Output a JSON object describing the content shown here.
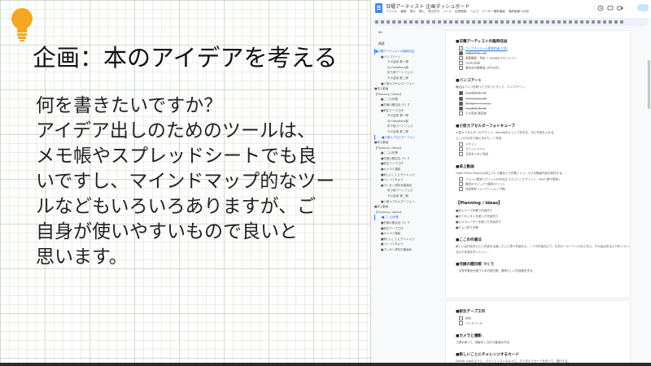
{
  "slide": {
    "title": "企画：本のアイデアを考える",
    "body_lines": [
      "何を書きたいですか？",
      "アイデア出しのためのツールは、",
      "メモ帳やスプレッドシートでも良",
      "いですし、マインドマップ的なツー",
      "ルなどもいろいろありますが、ご",
      "自身が使いやすいもので良いと",
      "思います。"
    ],
    "colors": {
      "bulb": "#f5a623",
      "grid": "#a0b996"
    }
  },
  "docs": {
    "title": "日曜アーティスト 企画ダッシュボード",
    "menu": [
      "ファイル",
      "編集",
      "表示",
      "挿入",
      "表示形式",
      "ツール",
      "拡張機能",
      "ヘルプ",
      "ユーザー補助機能",
      "最終編集:5分前"
    ],
    "icons": [
      "docs-logo-icon",
      "star-icon",
      "history-icon",
      "comment-icon",
      "video-icon",
      "share-icon"
    ],
    "outline": {
      "back_label": "←",
      "heading": "概要",
      "items": [
        {
          "label": "■日曜アーティストの臨時収益",
          "level": 1,
          "active": true
        },
        {
          "label": "■バンコアート",
          "level": 2,
          "active": false
        },
        {
          "label": "その芸術 第一弾",
          "level": 3,
          "active": false
        },
        {
          "label": "Art Relations部",
          "level": 3,
          "active": false
        },
        {
          "label": "折り紙アートフェス",
          "level": 3,
          "active": false
        },
        {
          "label": "その芸術 第二弾",
          "level": 3,
          "active": false
        },
        {
          "label": "■小型カプセルダーフォト",
          "level": 2,
          "active": false
        },
        {
          "label": "■卓上動画",
          "level": 1,
          "active": false
        },
        {
          "label": "【Planning / Ideas】",
          "level": 1,
          "active": false
        },
        {
          "label": "■ここの作業",
          "level": 2,
          "active": false
        },
        {
          "label": "■究極の題目目 づくり",
          "level": 2,
          "active": false
        },
        {
          "label": "■新生テープ工作",
          "level": 2,
          "active": false
        },
        {
          "label": "その芸術 第一弾",
          "level": 3,
          "active": false
        },
        {
          "label": "Art Relations部",
          "level": 3,
          "active": false
        },
        {
          "label": "折り紙アートフェス",
          "level": 3,
          "active": false
        },
        {
          "label": "その芸術 第二弾",
          "level": 3,
          "active": false
        },
        {
          "label": "■小型カプセルダーフォト",
          "level": 2,
          "active": true
        },
        {
          "label": "■卓上動画",
          "level": 1,
          "active": false
        },
        {
          "label": "【Planning / Ideas】",
          "level": 1,
          "active": false
        },
        {
          "label": "■ここの作業",
          "level": 2,
          "active": false
        },
        {
          "label": "■究極の題目目 づくり",
          "level": 2,
          "active": false
        },
        {
          "label": "■新生テープ工作",
          "level": 2,
          "active": false
        },
        {
          "label": "■カメラと撮影",
          "level": 2,
          "active": false
        },
        {
          "label": "■新しいことにチャレンジ",
          "level": 2,
          "active": false
        },
        {
          "label": "■つくってみよう",
          "level": 2,
          "active": false
        },
        {
          "label": "■プレゼン資料を動画化",
          "level": 2,
          "active": false
        },
        {
          "label": "折り紙アートフェス",
          "level": 3,
          "active": false
        },
        {
          "label": "その芸術 第二弾",
          "level": 3,
          "active": false
        },
        {
          "label": "■小型カプセルダーフォト",
          "level": 2,
          "active": false
        },
        {
          "label": "■卓上動画",
          "level": 1,
          "active": false
        },
        {
          "label": "【Planning / Ideas】",
          "level": 1,
          "active": false
        },
        {
          "label": "■ここの作業",
          "level": 2,
          "active": true
        },
        {
          "label": "■究極の題目目 づくり",
          "level": 2,
          "active": false
        },
        {
          "label": "■新生テープ工作",
          "level": 2,
          "active": false
        },
        {
          "label": "■カメラと撮影",
          "level": 2,
          "active": false
        },
        {
          "label": "■新しいことにチャレンジ",
          "level": 2,
          "active": false
        },
        {
          "label": "■つくってみよう",
          "level": 2,
          "active": false
        },
        {
          "label": "■プレゼン資料を動画化",
          "level": 2,
          "active": false
        }
      ]
    },
    "page1": {
      "sections": [
        {
          "heading": "■日曜アーティストの臨時収益",
          "text": [],
          "checks": [
            {
              "label": "ライブストリーム配信計画 (7月)",
              "state": "link"
            },
            {
              "label": "作業系準備 一覧",
              "state": "done"
            },
            {
              "label": "振替確認・特定 → Googleドキュメント",
              "state": "off"
            },
            {
              "label": "Hooks企画",
              "state": "off"
            },
            {
              "label": "優先交付業務量 (4円以内)",
              "state": "off"
            }
          ]
        },
        {
          "heading": "■バンコアート",
          "text": [
            "最近はバンコを彫ったり作ったりして、バンコアート。"
          ],
          "checks": [
            {
              "label": "その芸術 第一弾",
              "state": "done"
            },
            {
              "label": "Art Relations部",
              "state": "done"
            },
            {
              "label": "折り紙アートフェス",
              "state": "done"
            },
            {
              "label": "その芸術 第二弾",
              "state": "done"
            },
            {
              "label": "その芸術 第四弾",
              "state": "off"
            }
          ]
        },
        {
          "heading": "■小型カプセルダーフォトキューブ",
          "text": [
            "小型カプセルダーのデザイン、Sofubbのキューブを作る。中に写真を入れる。",
            "どこかのお店で使えるかも…→ 作品"
          ],
          "checks": [
            {
              "label": "デザイン",
              "state": "off"
            },
            {
              "label": "プリントアウト",
              "state": "off"
            },
            {
              "label": "写真を入れて完成",
              "state": "off"
            }
          ]
        },
        {
          "heading": "■卓上動画",
          "text": [
            "Open Press Projectの卓上プレス機などで作業シリン、小さな動画作品を制作する。"
          ],
          "checks": [
            {
              "label": "イメージ配布 (プリントの方式は【ゴンビニでプリント、Gsef (便で配布)",
              "state": "off"
            },
            {
              "label": "素材のマジックで配布プリント",
              "state": "off"
            },
            {
              "label": "作品制作 (ユーラーショップ他)",
              "state": "off"
            }
          ]
        }
      ],
      "planning_heading": "【Planning / Ideas】",
      "planning_items": [
        "■卓上テープ作業で作品作り",
        "■ガーゼンタンを使った作品作り",
        "■カメラレーザーを使った作品作り",
        "■チョコ作り作業"
      ],
      "sections2": [
        {
          "heading": "■ここの作業法",
          "text": [
            "新しい会作品をもとに作品を企画したいと思う作品など。ノフの作品などで、紅白ケーキーベリやなどなど。その会は作るより作っていく作品も",
            "なので作品を作っていく..."
          ]
        },
        {
          "heading": "■究極の題目帳 づくり",
          "text": [
            "・文房作業品を使うための題日帳、素晴らしい作品帳を作る"
          ]
        }
      ]
    },
    "page2": {
      "sections": [
        {
          "heading": "■新生テープ工作",
          "text": [],
          "checks": [
            {
              "label": "材料",
              "state": "off"
            },
            {
              "label": "ハンドツール",
              "state": "off"
            }
          ]
        },
        {
          "heading": "■カメラと撮影",
          "text": [
            "三脚を使って、撮影をしながら動画を作る"
          ],
          "checks": []
        },
        {
          "heading": "■新しいことにチャレンジするカード",
          "text": [
            "Dinner cupのように、パラッとリストのように、デジタルでカードを作って、運行する。"
          ],
          "checks": []
        }
      ]
    }
  }
}
